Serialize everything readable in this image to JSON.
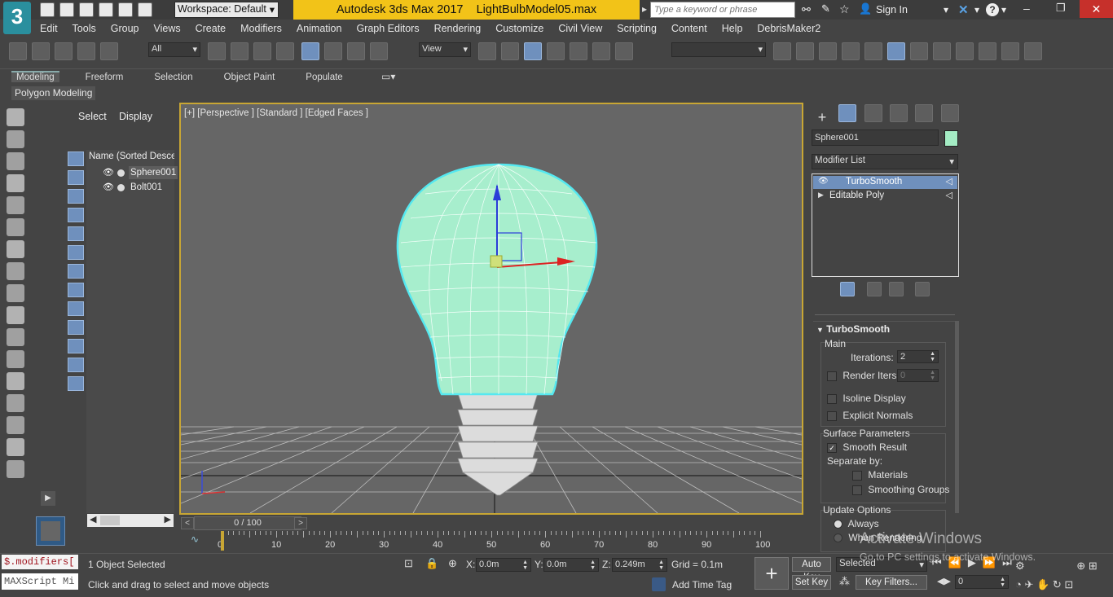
{
  "title_bar": {
    "app_badge": "3",
    "workspace": "Workspace: Default",
    "title": "Autodesk 3ds Max 2017",
    "filename": "LightBulbModel05.max",
    "search_placeholder": "Type a keyword or phrase",
    "sign_in": "Sign In",
    "help": "?",
    "colors": {
      "title_bg": "#f2c318",
      "dark": "#3c3c3c"
    }
  },
  "menu": [
    "Edit",
    "Tools",
    "Group",
    "Views",
    "Create",
    "Modifiers",
    "Animation",
    "Graph Editors",
    "Rendering",
    "Customize",
    "Civil View",
    "Scripting",
    "Content",
    "Help",
    "DebrisMaker2"
  ],
  "toolbar": {
    "filter": "All",
    "ref_coord": "View"
  },
  "ribbon": {
    "tabs": [
      "Modeling",
      "Freeform",
      "Selection",
      "Object Paint",
      "Populate"
    ],
    "panel": "Polygon Modeling"
  },
  "scene_explorer": {
    "tabs": [
      "Select",
      "Display"
    ],
    "column": "Name (Sorted Descen",
    "items": [
      {
        "label": "Sphere001"
      },
      {
        "label": "Bolt001"
      }
    ]
  },
  "viewport": {
    "label": "[+] [Perspective ] [Standard ] [Edged Faces ]"
  },
  "command_panel": {
    "object_name": "Sphere001",
    "object_color": "#a4ecc4",
    "modifier_list": "Modifier List",
    "stack": [
      {
        "label": "TurboSmooth"
      },
      {
        "label": "Editable Poly"
      }
    ],
    "rollout_title": "TurboSmooth",
    "main": "Main",
    "iterations_label": "Iterations:",
    "iterations": "2",
    "render_iters_label": "Render Iters:",
    "render_iters": "0",
    "isoline": "Isoline Display",
    "explicit": "Explicit Normals",
    "surface_params": "Surface Parameters",
    "smooth_result": "Smooth Result",
    "separate_by": "Separate by:",
    "materials": "Materials",
    "smoothing_groups": "Smoothing Groups",
    "update_options": "Update Options",
    "always": "Always",
    "when_rendering": "When Rendering"
  },
  "timeline": {
    "frame": "0 / 100",
    "ticks": [
      "0",
      "10",
      "20",
      "30",
      "40",
      "50",
      "60",
      "70",
      "80",
      "90",
      "100"
    ]
  },
  "status": {
    "maxscript_cmd": "$.modifiers[",
    "maxscript_listener": "MAXScript Mi",
    "selection": "1 Object Selected",
    "prompt": "Click and drag to select and move objects",
    "x_label": "X:",
    "x": "0.0m",
    "y_label": "Y:",
    "y": "0.0m",
    "z_label": "Z:",
    "z": "0.249m",
    "grid": "Grid = 0.1m",
    "add_time_tag": "Add Time Tag",
    "auto_key": "Auto Key",
    "set_key": "Set Key",
    "key_mode": "Selected",
    "key_filters": "Key Filters...",
    "frame_field": "0"
  },
  "watermark": {
    "line1": "Activate Windows",
    "line2": "Go to PC settings to activate Windows."
  }
}
